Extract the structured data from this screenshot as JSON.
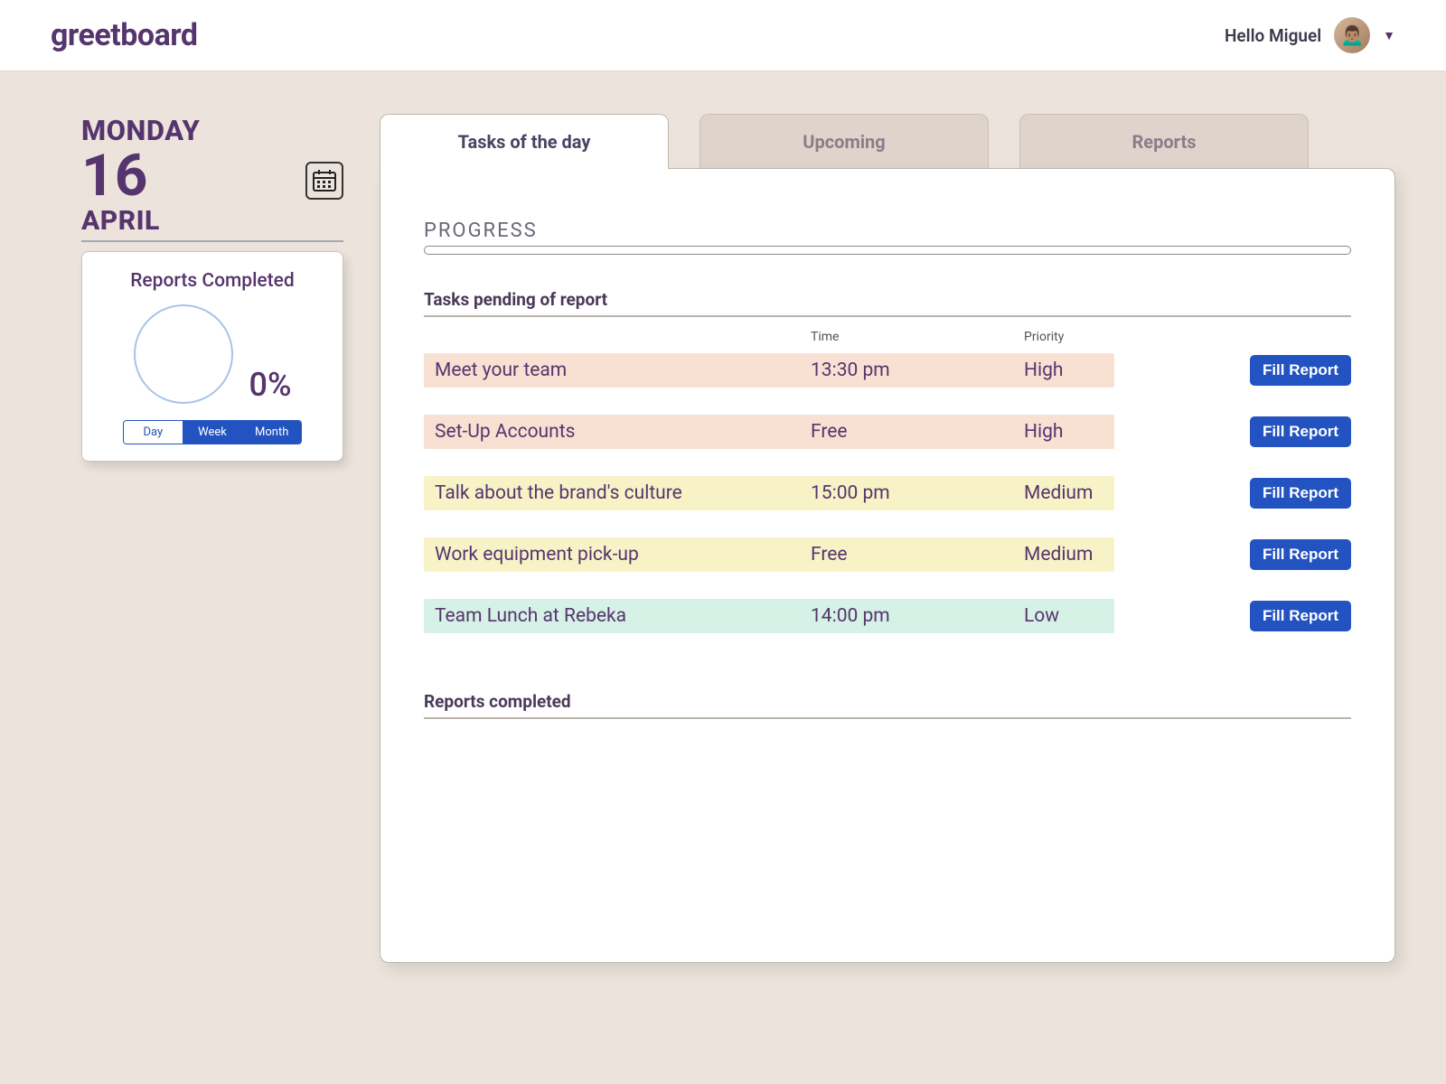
{
  "header": {
    "logo": "greetboard",
    "greeting": "Hello  Miguel"
  },
  "sidebar": {
    "day_name": "MONDAY",
    "day_number": "16",
    "month": "APRIL",
    "card_title": "Reports Completed",
    "percent": "0%",
    "range": {
      "day": "Day",
      "week": "Week",
      "month": "Month"
    }
  },
  "tabs": {
    "tasks": "Tasks of the day",
    "upcoming": "Upcoming",
    "reports": "Reports"
  },
  "panel": {
    "progress_label": "PROGRESS",
    "pending_heading": "Tasks  pending of report",
    "col_time": "Time",
    "col_priority": "Priority",
    "fill_label": "Fill  Report",
    "completed_heading": "Reports completed",
    "tasks": [
      {
        "name": "Meet your team",
        "time": "13:30 pm",
        "priority": "High",
        "level": "high"
      },
      {
        "name": "Set-Up  Accounts",
        "time": "Free",
        "priority": "High",
        "level": "high"
      },
      {
        "name": "Talk about the brand's culture",
        "time": "15:00 pm",
        "priority": "Medium",
        "level": "medium"
      },
      {
        "name": "Work equipment pick-up",
        "time": "Free",
        "priority": "Medium",
        "level": "medium"
      },
      {
        "name": "Team Lunch at Rebeka",
        "time": "14:00 pm",
        "priority": "Low",
        "level": "low"
      }
    ]
  }
}
